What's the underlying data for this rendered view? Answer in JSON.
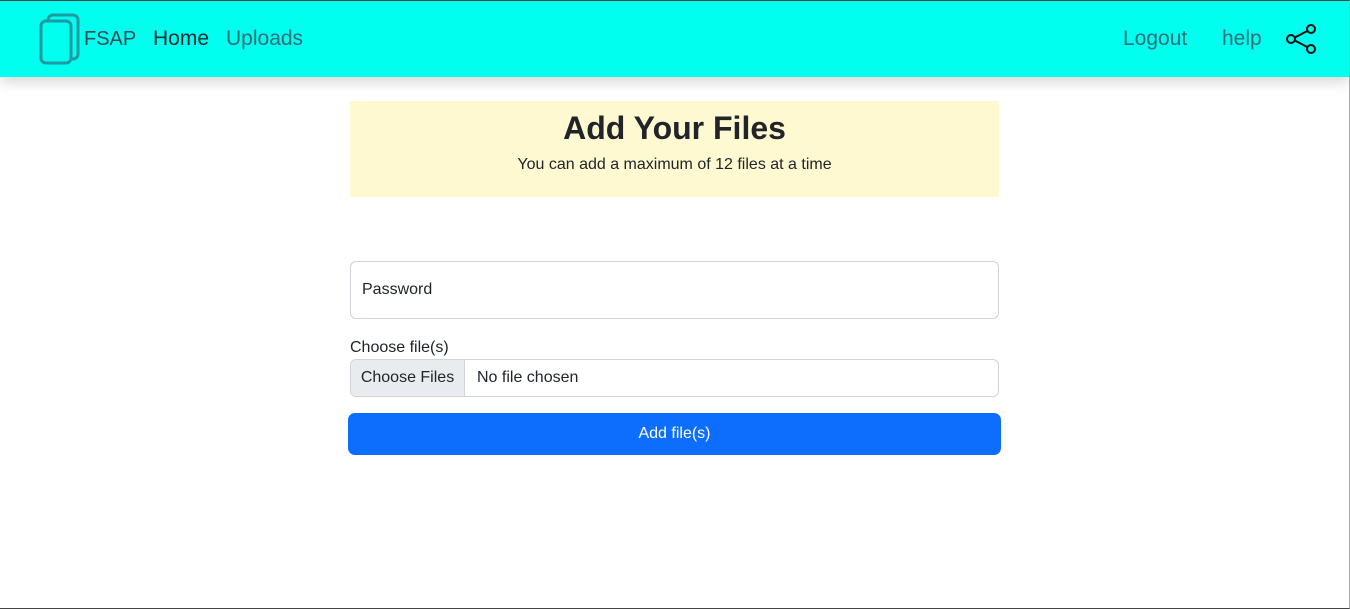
{
  "colors": {
    "navbar_bg": "#00ffef",
    "banner_bg": "#fff9d1",
    "primary_button": "#0d6efd",
    "brand_icon": "#1f9aa3"
  },
  "navbar": {
    "brand": "FSAP",
    "brand_icon": "stacked-files-icon",
    "links": {
      "home": "Home",
      "uploads": "Uploads",
      "logout": "Logout",
      "help": "help"
    },
    "share_icon": "share-icon",
    "active_link": "home"
  },
  "banner": {
    "title": "Add Your Files",
    "subtitle": "You can add a maximum of 12 files at a time"
  },
  "form": {
    "password_placeholder": "Password",
    "password_value": "",
    "file_label": "Choose file(s)",
    "file_button": "Choose Files",
    "file_status": "No file chosen",
    "submit_label": "Add file(s)"
  }
}
